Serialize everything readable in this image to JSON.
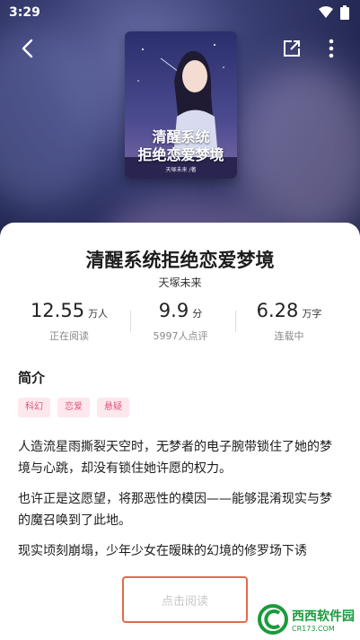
{
  "status_bar": {
    "time": "3:29"
  },
  "book": {
    "title": "清醒系统拒绝恋爱梦境",
    "author": "天塚未来",
    "cover_title_line1": "清醒系统",
    "cover_title_line2": "拒绝恋爱梦境",
    "cover_author": "天塚未来 /著"
  },
  "stats": [
    {
      "value": "12.55",
      "unit": "万人",
      "label": "正在阅读"
    },
    {
      "value": "9.9",
      "unit": "分",
      "label": "5997人点评"
    },
    {
      "value": "6.28",
      "unit": "万字",
      "label": "连载中"
    }
  ],
  "intro": {
    "heading": "简介",
    "tags": [
      "科幻",
      "恋爱",
      "悬疑"
    ],
    "paragraphs": [
      "人造流星雨撕裂天空时，无梦者的电子腕带锁住了她的梦境与心跳，却没有锁住她许愿的权力。",
      "也许正是这愿望，将那恶性的模因——能够混淆现实与梦的魔召唤到了此地。",
      "现实顷刻崩塌，少年少女在暧昧的幻境的修罗场下诱"
    ]
  },
  "actions": {
    "read_label": "点击阅读"
  },
  "watermark": {
    "brand": "西西软件园",
    "site": "CR173.COM"
  },
  "colors": {
    "tag_bg": "#fde8ee",
    "tag_text": "#e0577c",
    "highlight_border": "#e26a4b",
    "watermark": "#1a9b3a"
  }
}
